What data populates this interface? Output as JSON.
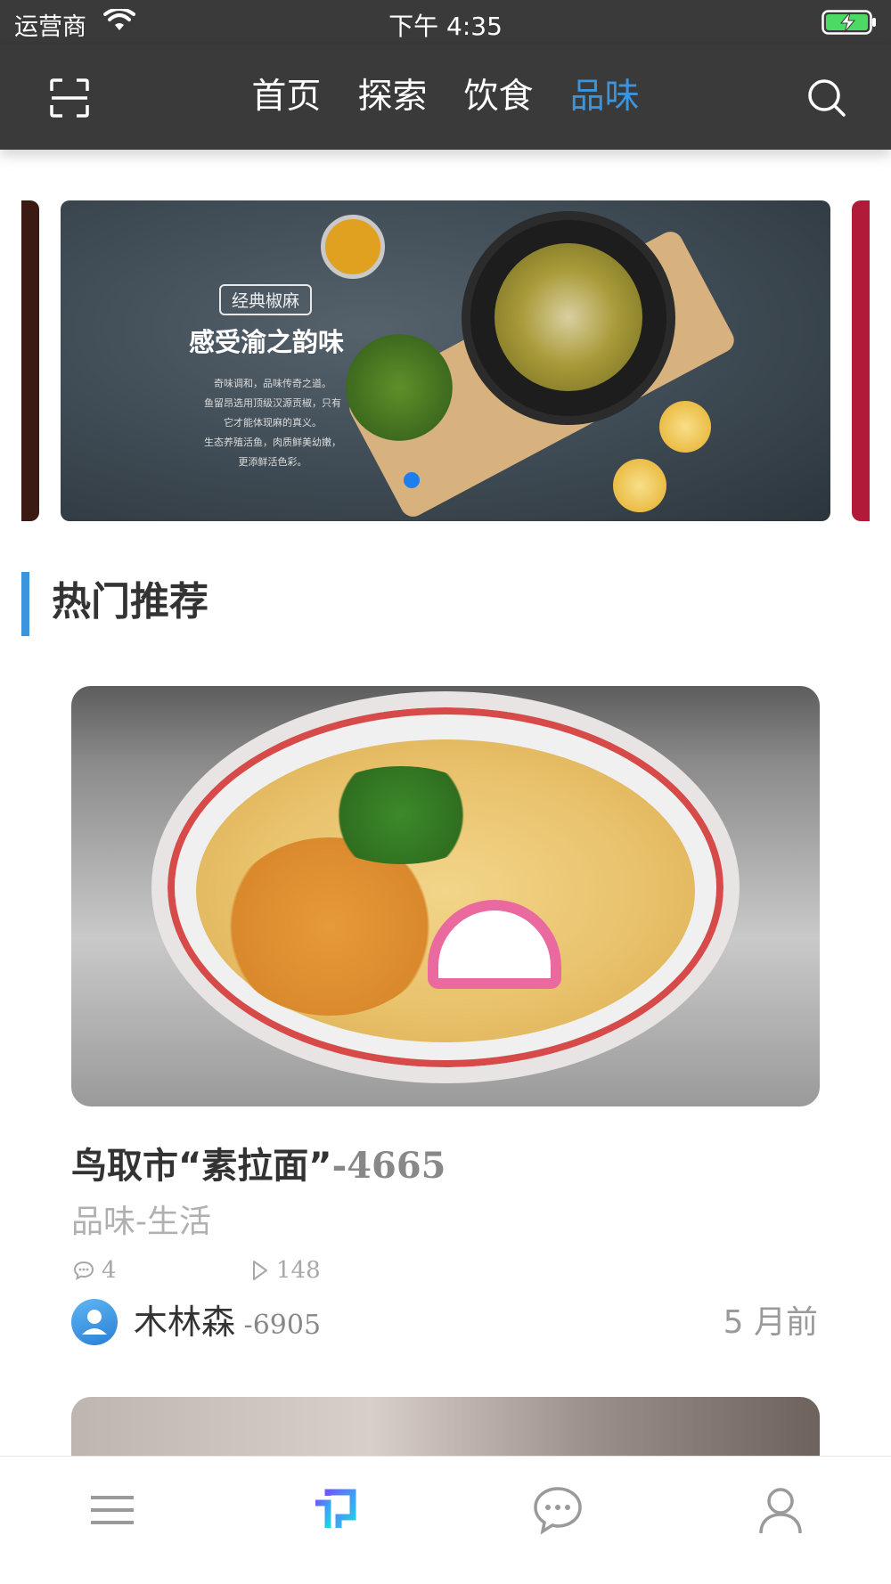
{
  "status_bar": {
    "carrier": "运营商",
    "time": "下午 4:35"
  },
  "nav": {
    "tabs": [
      {
        "label": "首页",
        "active": false
      },
      {
        "label": "探索",
        "active": false
      },
      {
        "label": "饮食",
        "active": false
      },
      {
        "label": "品味",
        "active": true
      }
    ],
    "active_color": "#3b94dc",
    "left_icon": "scan-icon",
    "right_icon": "search-icon"
  },
  "banner": {
    "tag": "经典椒麻",
    "title": "感受渝之韵味",
    "description_lines": [
      "奇味调和，品味传奇之道。",
      "鱼留昂选用顶级汉源贡椒，只有",
      "它才能体现麻的真义。",
      "生态养殖活鱼，肉质鲜美幼嫩，",
      "更添鲜活色彩。"
    ],
    "indicator_color": "#1d7ef0"
  },
  "section": {
    "title": "热门推荐",
    "accent_color": "#3b94dc"
  },
  "card": {
    "title": "鸟取市“素拉面”",
    "title_suffix": "-4665",
    "category": "品味-生活",
    "comments": "4",
    "plays": "148",
    "author": "木林森",
    "author_suffix": " -6905",
    "time": "5 月前"
  },
  "tabbar": {
    "items": [
      "menu-icon",
      "discover-icon",
      "chat-icon",
      "profile-icon"
    ],
    "active": "discover-icon"
  }
}
